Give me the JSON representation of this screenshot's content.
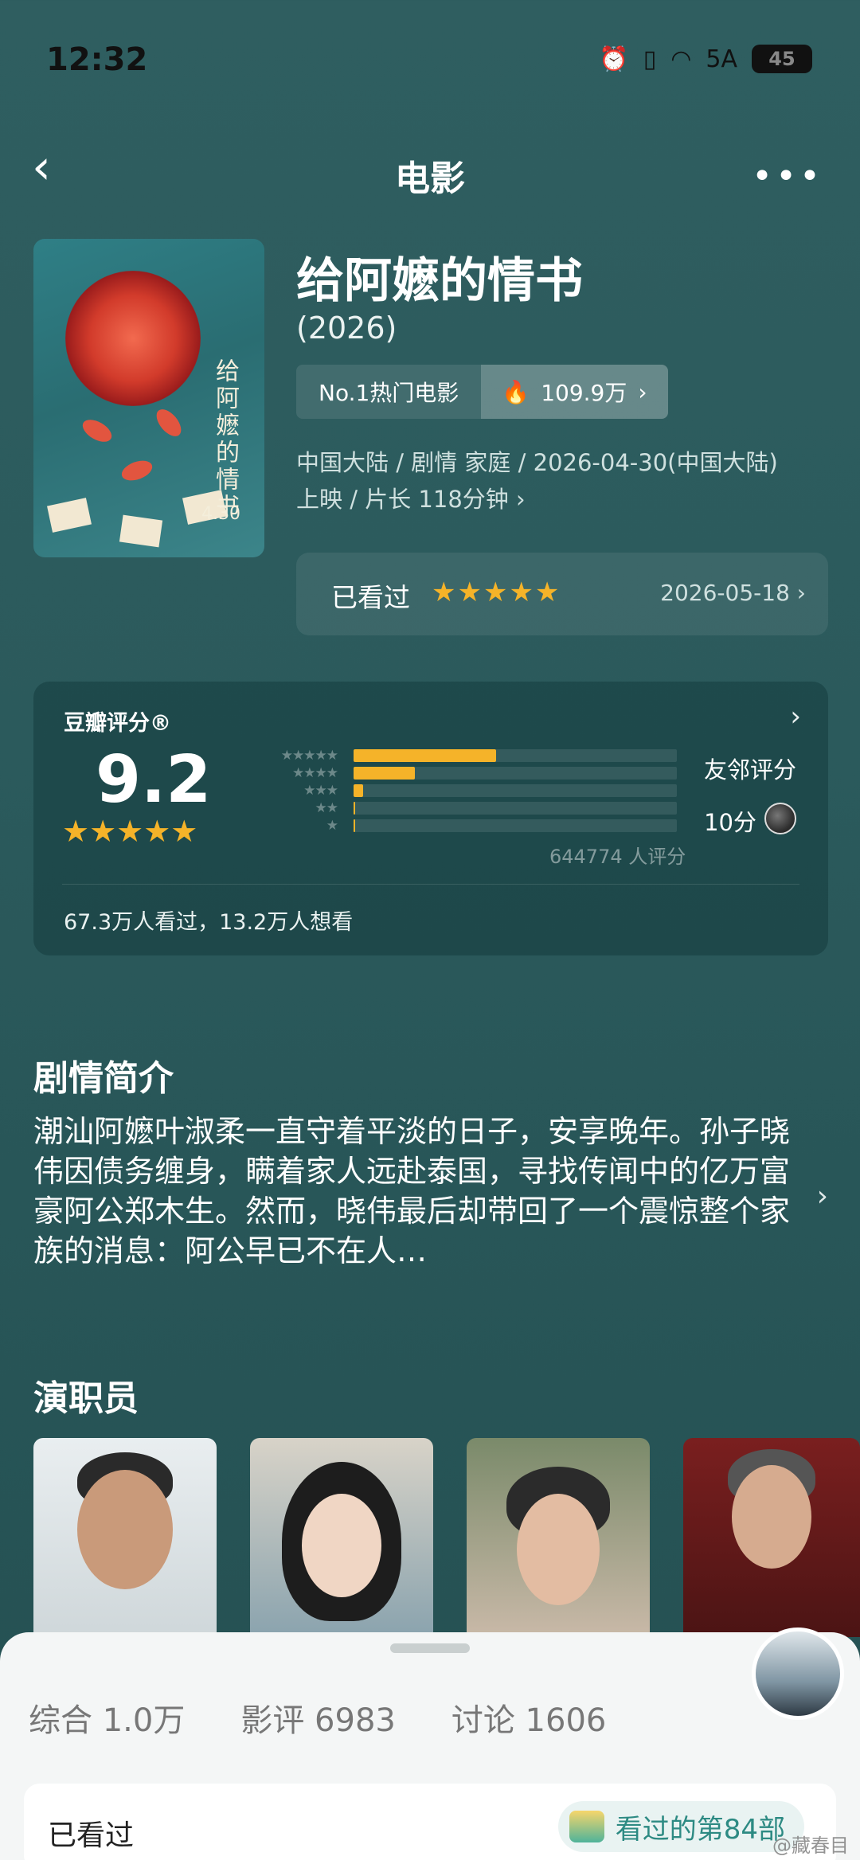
{
  "status_bar": {
    "time": "12:32",
    "network": "5A",
    "battery": "45"
  },
  "nav": {
    "title": "电影",
    "back_icon": "chevron-left-icon",
    "more_icon": "more-icon"
  },
  "movie": {
    "title": "给阿嬷的情书",
    "year": "(2026)",
    "rank_label": "No.1热门电影",
    "heat_value": "109.9万",
    "meta_line1": "中国大陆 / 剧情 家庭 / 2026-04-30(中国大陆)",
    "meta_line2": "上映 / 片长 118分钟",
    "poster_title": "给阿嬷的情书",
    "poster_date": "4.30"
  },
  "watched": {
    "label": "已看过",
    "stars": "★★★★★",
    "date": "2026-05-18"
  },
  "rating": {
    "title": "豆瓣评分®",
    "score": "9.2",
    "stars": "★★★★★",
    "distribution": [
      {
        "stars": "★★★★★",
        "fraction": 0.44
      },
      {
        "stars": "★★★★",
        "fraction": 0.19
      },
      {
        "stars": "★★★",
        "fraction": 0.03
      },
      {
        "stars": "★★",
        "fraction": 0.005
      },
      {
        "stars": "★",
        "fraction": 0.002
      }
    ],
    "friends_label": "友邻评分",
    "friends_score": "10分",
    "count": "644774 人评分",
    "footer": "67.3万人看过，13.2万人想看"
  },
  "synopsis": {
    "title": "剧情简介",
    "body": "潮汕阿嬷叶淑柔一直守着平淡的日子，安享晚年。孙子晓伟因债务缠身，瞒着家人远赴泰国，寻找传闻中的亿万富豪阿公郑木生。然而，晓伟最后却带回了一个震惊整个家族的消息：阿公早已不在人…"
  },
  "cast": {
    "title": "演职员"
  },
  "sheet": {
    "tabs": [
      {
        "label": "综合 1.0万"
      },
      {
        "label": "影评 6983"
      },
      {
        "label": "讨论 1606"
      }
    ],
    "watched_label": "已看过",
    "badge_label": "看过的第84部",
    "watermark": "@藏春目"
  },
  "colors": {
    "background": "#2b5a5c",
    "star": "#f5b329",
    "sheet": "#f4f6f6",
    "accent": "#2d8a83"
  }
}
